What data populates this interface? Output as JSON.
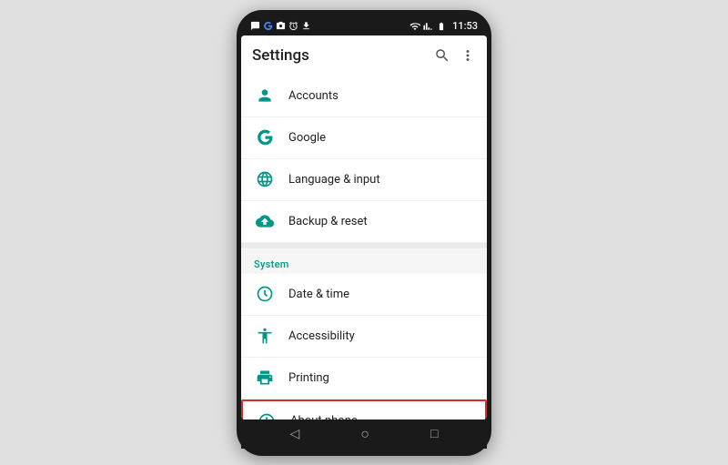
{
  "statusBar": {
    "time": "11:53",
    "leftIcons": [
      "msg-icon",
      "g-icon",
      "cam-icon",
      "alarm-icon",
      "download-icon"
    ],
    "rightIcons": [
      "wifi",
      "signal",
      "battery"
    ]
  },
  "appBar": {
    "title": "Settings",
    "searchLabel": "search",
    "moreLabel": "more options"
  },
  "sections": [
    {
      "id": "personal",
      "label": null,
      "items": [
        {
          "id": "accounts",
          "icon": "person-icon",
          "text": "Accounts",
          "highlighted": false
        },
        {
          "id": "google",
          "icon": "google-icon",
          "text": "Google",
          "highlighted": false
        },
        {
          "id": "language",
          "icon": "globe-icon",
          "text": "Language & input",
          "highlighted": false
        },
        {
          "id": "backup",
          "icon": "cloud-icon",
          "text": "Backup & reset",
          "highlighted": false
        }
      ]
    },
    {
      "id": "system",
      "label": "System",
      "items": [
        {
          "id": "datetime",
          "icon": "clock-icon",
          "text": "Date & time",
          "highlighted": false
        },
        {
          "id": "accessibility",
          "icon": "accessibility-icon",
          "text": "Accessibility",
          "highlighted": false
        },
        {
          "id": "printing",
          "icon": "print-icon",
          "text": "Printing",
          "highlighted": false
        },
        {
          "id": "about",
          "icon": "info-icon",
          "text": "About phone",
          "highlighted": true
        }
      ]
    }
  ],
  "navBar": {
    "backLabel": "◁",
    "homeLabel": "○",
    "recentLabel": "□"
  }
}
